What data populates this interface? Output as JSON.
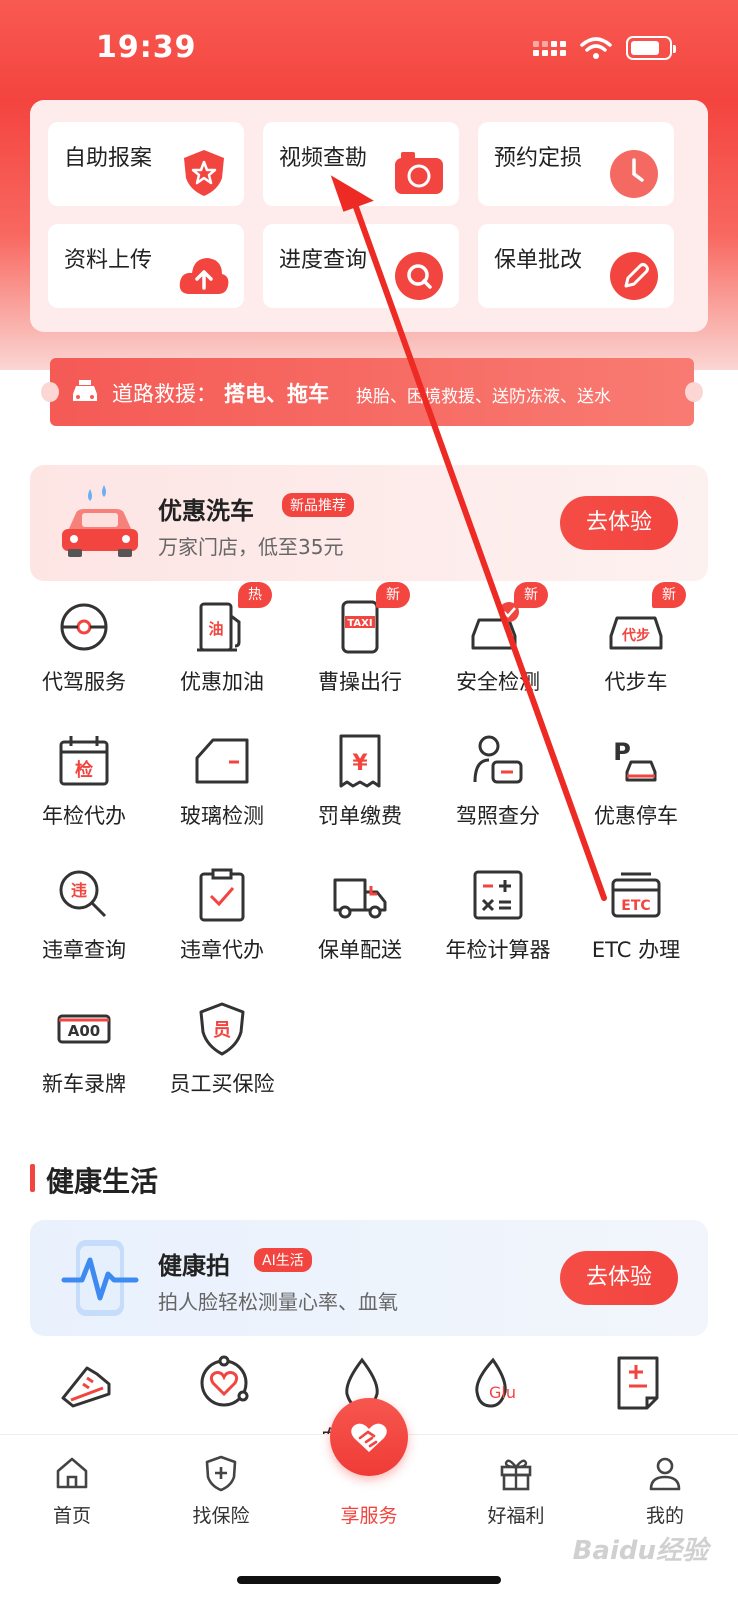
{
  "status_bar": {
    "time": "19:39"
  },
  "quick_tools": [
    {
      "label": "自助报案",
      "icon": "shield-star-icon"
    },
    {
      "label": "视频查勘",
      "icon": "camera-icon"
    },
    {
      "label": "预约定损",
      "icon": "clock-icon"
    },
    {
      "label": "资料上传",
      "icon": "cloud-upload-icon"
    },
    {
      "label": "进度查询",
      "icon": "magnifier-icon"
    },
    {
      "label": "保单批改",
      "icon": "pen-icon"
    }
  ],
  "rescue_banner": {
    "prefix": "道路救援：",
    "highlight": "搭电、拖车",
    "rest": "换胎、困境救援、送防冻液、送水"
  },
  "car_wash": {
    "title": "优惠洗车",
    "badge": "新品推荐",
    "subtitle": "万家门店，低至35元",
    "cta": "去体验"
  },
  "services": [
    {
      "label": "代驾服务",
      "icon": "steering-wheel-icon",
      "tag": ""
    },
    {
      "label": "优惠加油",
      "icon": "fuel-pump-icon",
      "tag": "热"
    },
    {
      "label": "曹操出行",
      "icon": "taxi-phone-icon",
      "tag": "新",
      "icon_text": "TAXI"
    },
    {
      "label": "安全检测",
      "icon": "car-check-icon",
      "tag": "新"
    },
    {
      "label": "代步车",
      "icon": "replacement-car-icon",
      "tag": "新",
      "icon_text": "代步"
    },
    {
      "label": "年检代办",
      "icon": "calendar-check-icon",
      "tag": "",
      "icon_text": "检"
    },
    {
      "label": "玻璃检测",
      "icon": "car-glass-icon",
      "tag": ""
    },
    {
      "label": "罚单缴费",
      "icon": "ticket-yuan-icon",
      "tag": "",
      "icon_text": "¥"
    },
    {
      "label": "驾照查分",
      "icon": "license-icon",
      "tag": ""
    },
    {
      "label": "优惠停车",
      "icon": "parking-icon",
      "tag": "",
      "icon_text": "P"
    },
    {
      "label": "违章查询",
      "icon": "violation-search-icon",
      "tag": "",
      "icon_text": "违"
    },
    {
      "label": "违章代办",
      "icon": "clipboard-check-icon",
      "tag": ""
    },
    {
      "label": "保单配送",
      "icon": "delivery-truck-icon",
      "tag": ""
    },
    {
      "label": "年检计算器",
      "icon": "calculator-icon",
      "tag": ""
    },
    {
      "label": "ETC 办理",
      "icon": "etc-card-icon",
      "tag": "",
      "icon_text": "ETC"
    },
    {
      "label": "新车录牌",
      "icon": "license-plate-icon",
      "tag": "",
      "icon_text": "A00"
    },
    {
      "label": "员工买保险",
      "icon": "employee-shield-icon",
      "tag": "",
      "icon_text": "员"
    }
  ],
  "health_section": {
    "title": "健康生活",
    "card": {
      "title": "健康拍",
      "badge": "AI生活",
      "subtitle": "拍人脸轻松测量心率、血氧",
      "cta": "去体验"
    },
    "items": [
      {
        "label": "",
        "icon": "sneaker-icon"
      },
      {
        "label": "",
        "icon": "heart-cycle-icon"
      },
      {
        "label": "血糖管理",
        "icon": "blood-drop-icon"
      },
      {
        "label": "",
        "icon": "glucose-icon",
        "icon_text": "Glu"
      },
      {
        "label": "",
        "icon": "medical-record-icon"
      }
    ]
  },
  "tab_bar": [
    {
      "label": "首页",
      "icon": "home-icon",
      "active": false
    },
    {
      "label": "找保险",
      "icon": "shield-plus-icon",
      "active": false
    },
    {
      "label": "享服务",
      "icon": "handshake-heart-icon",
      "active": true
    },
    {
      "label": "好福利",
      "icon": "gift-icon",
      "active": false
    },
    {
      "label": "我的",
      "icon": "person-icon",
      "active": false
    }
  ],
  "watermark": "Baidu经验",
  "colors": {
    "brand_red": "#f2453f",
    "icon_dark": "#333333",
    "tab_active": "#f2453f"
  }
}
